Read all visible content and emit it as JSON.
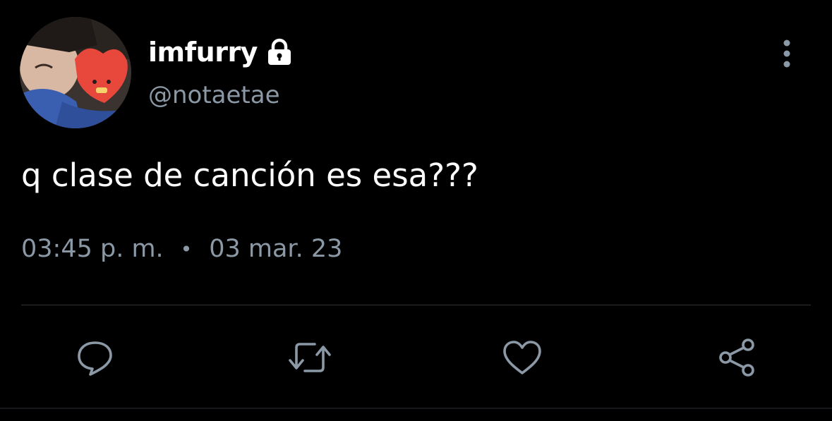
{
  "tweet": {
    "author": {
      "display_name": "imfurry",
      "handle": "@notaetae",
      "protected_icon": "lock-icon",
      "avatar_icon": "avatar-photo"
    },
    "text": "q clase de canción es esa???",
    "time": "03:45 p. m.",
    "separator": "•",
    "date": "03 mar. 23"
  },
  "actions": [
    {
      "name": "reply",
      "icon": "reply-icon"
    },
    {
      "name": "retweet",
      "icon": "retweet-icon"
    },
    {
      "name": "like",
      "icon": "heart-icon"
    },
    {
      "name": "share",
      "icon": "share-icon"
    }
  ],
  "menu": {
    "icon": "more-vertical-icon"
  },
  "colors": {
    "background": "#000000",
    "primary_text": "#ffffff",
    "secondary_text": "#8b98a5",
    "divider": "#2f3336"
  }
}
